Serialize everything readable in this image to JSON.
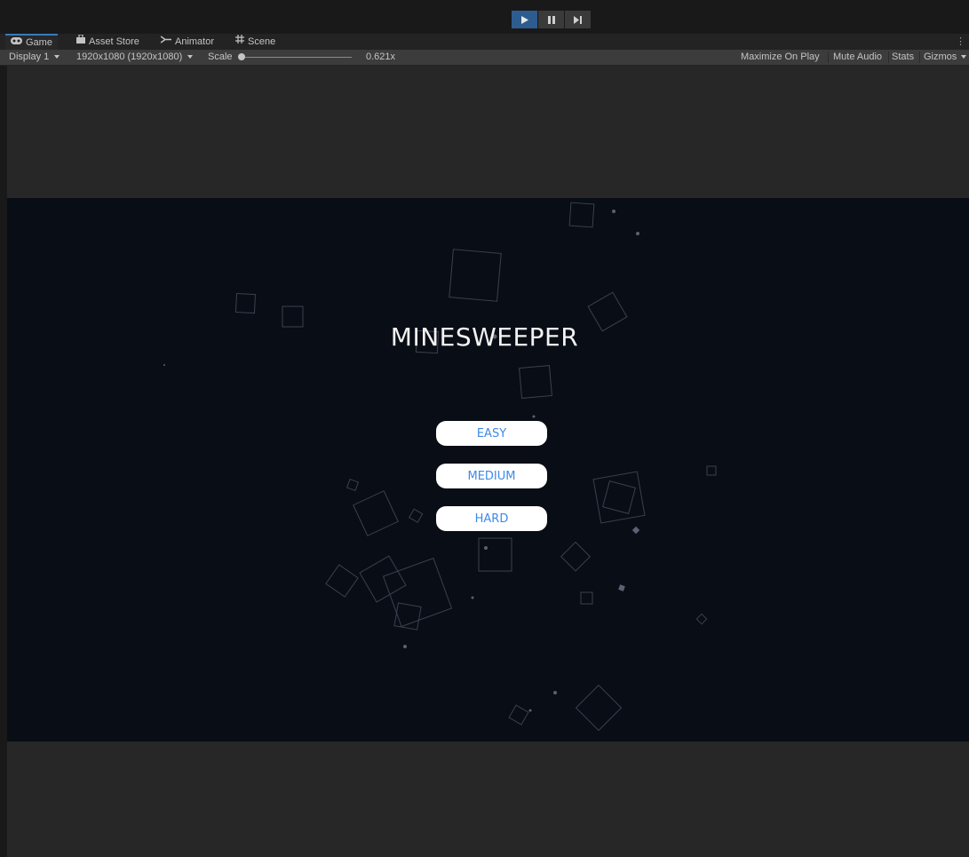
{
  "play_controls": {
    "play_icon": "play-icon",
    "pause_icon": "pause-icon",
    "step_icon": "step-icon",
    "active_color": "#2d5d8f"
  },
  "tabs": [
    {
      "label": "Game",
      "icon": "gamepad-icon",
      "active": true
    },
    {
      "label": "Asset Store",
      "icon": "bag-icon",
      "active": false
    },
    {
      "label": "Animator",
      "icon": "animator-icon",
      "active": false
    },
    {
      "label": "Scene",
      "icon": "grid-icon",
      "active": false
    }
  ],
  "toolbar": {
    "display": "Display 1",
    "resolution": "1920x1080 (1920x1080)",
    "scale_label": "Scale",
    "scale_value": "0.621x",
    "maximize": "Maximize On Play",
    "mute": "Mute Audio",
    "stats": "Stats",
    "gizmos": "Gizmos"
  },
  "game": {
    "title": "MINESWEEPER",
    "buttons": [
      "EASY",
      "MEDIUM",
      "HARD"
    ],
    "background_color": "#090d15",
    "button_text_color": "#3e8ae8"
  }
}
